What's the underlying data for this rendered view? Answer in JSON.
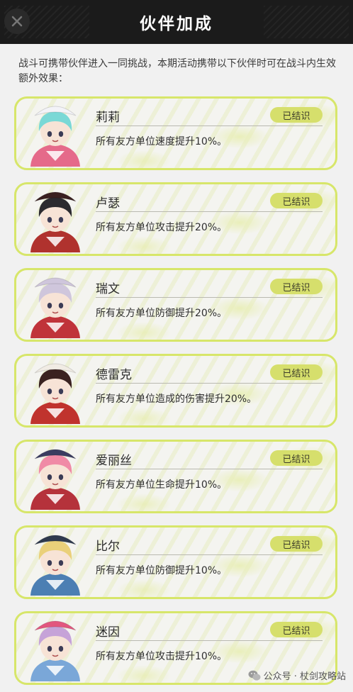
{
  "header": {
    "title": "伙伴加成"
  },
  "intro": "战斗可携带伙伴进入一同挑战，本期活动携带以下伙伴时可在战斗内生效额外效果：",
  "partners": [
    {
      "name": "莉莉",
      "status": "已结识",
      "effect": "所有友方单位速度提升10%。",
      "hair": "#7ad8d6",
      "hat": "#f3f3f8",
      "accent": "#e56a8a"
    },
    {
      "name": "卢瑟",
      "status": "已结识",
      "effect": "所有友方单位攻击提升20%。",
      "hair": "#2b2a2f",
      "hat": "#3a2020",
      "accent": "#b0322e"
    },
    {
      "name": "瑞文",
      "status": "已结识",
      "effect": "所有友方单位防御提升20%。",
      "hair": "#cfc6dc",
      "hat": "#cfc6dc",
      "accent": "#c0333a"
    },
    {
      "name": "德雷克",
      "status": "已结识",
      "effect": "所有友方单位造成的伤害提升20%。",
      "hair": "#3a2220",
      "hat": "#f1ece4",
      "accent": "#c0332d"
    },
    {
      "name": "爱丽丝",
      "status": "已结识",
      "effect": "所有友方单位生命提升10%。",
      "hair": "#f08aa6",
      "hat": "#3a3c60",
      "accent": "#b5323b"
    },
    {
      "name": "比尔",
      "status": "已结识",
      "effect": "所有友方单位防御提升10%。",
      "hair": "#ead07a",
      "hat": "#2f3a4e",
      "accent": "#4c7fb3"
    },
    {
      "name": "迷因",
      "status": "已结识",
      "effect": "所有友方单位攻击提升10%。",
      "hair": "#c6a3d8",
      "hat": "#e2567e",
      "accent": "#7aa7d8"
    }
  ],
  "watermark": {
    "text": "公众号 · 杖剑攻略站"
  }
}
